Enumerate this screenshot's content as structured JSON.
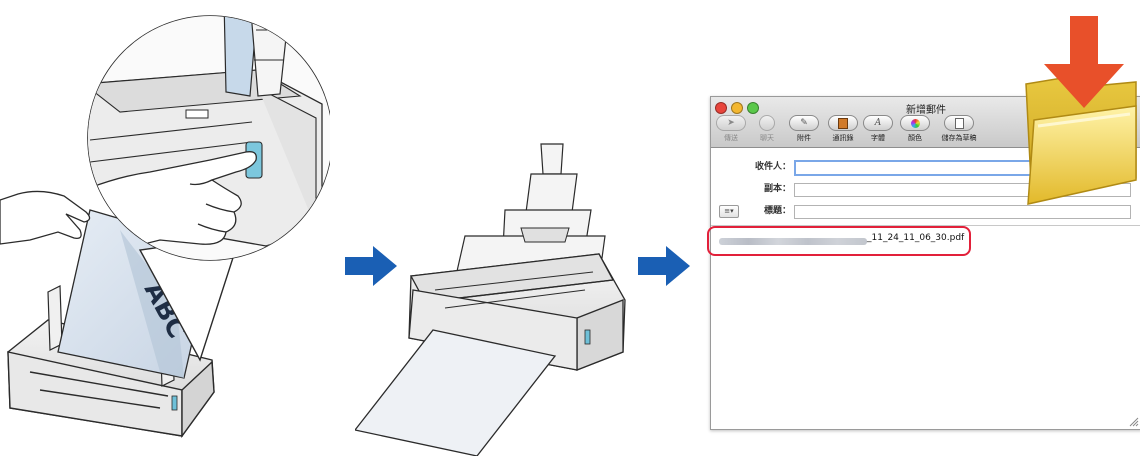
{
  "mail_window": {
    "title": "新增郵件",
    "toolbar": [
      {
        "label": "傳送",
        "icon": "send-icon",
        "enabled": false
      },
      {
        "label": "聊天",
        "icon": "chat-icon",
        "enabled": false
      },
      {
        "label": "附件",
        "icon": "attach-icon",
        "enabled": true
      },
      {
        "label": "通訊錄",
        "icon": "address-book-icon",
        "enabled": true
      },
      {
        "label": "字體",
        "icon": "font-icon",
        "enabled": true
      },
      {
        "label": "顏色",
        "icon": "color-icon",
        "enabled": true
      },
      {
        "label": "儲存為草稿",
        "icon": "draft-icon",
        "enabled": true
      }
    ],
    "fields": {
      "to_label": "收件人：",
      "cc_label": "副本：",
      "subject_label": "標題：",
      "to_value": "",
      "cc_value": "",
      "subject_value": ""
    },
    "attachment": {
      "filename_visible": "_11_24_11_06_30.pdf"
    }
  },
  "colors": {
    "arrow_blue": "#1a5fb4",
    "drop_arrow_red": "#e8502a",
    "attachment_highlight": "#e2203a",
    "folder_yellow": "#f2d24a"
  },
  "icons": [
    "hand-pointer-icon",
    "scanner-icon",
    "flow-arrow-icon",
    "folder-icon",
    "drop-arrow-icon"
  ]
}
